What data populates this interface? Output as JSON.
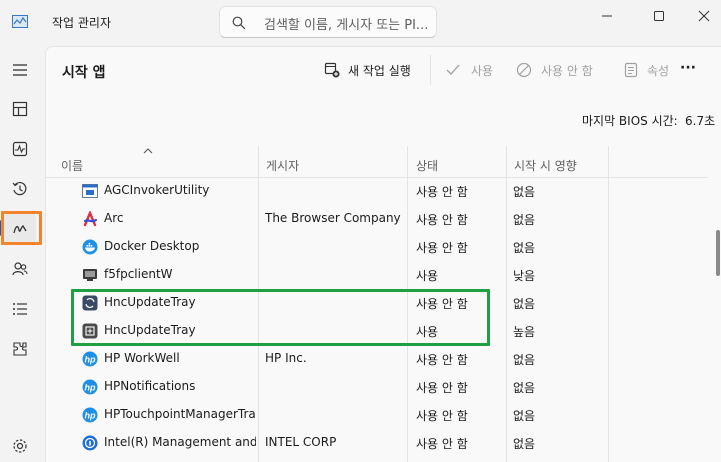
{
  "window": {
    "title": "작업 관리자",
    "search_placeholder": "검색할 이름, 게시자 또는 PI..."
  },
  "rail": [
    {
      "name": "menu-icon"
    },
    {
      "name": "processes-icon"
    },
    {
      "name": "performance-icon"
    },
    {
      "name": "app-history-icon"
    },
    {
      "name": "startup-apps-icon",
      "active": true
    },
    {
      "name": "users-icon"
    },
    {
      "name": "details-icon"
    },
    {
      "name": "services-icon"
    },
    {
      "name": "settings-icon"
    }
  ],
  "page": {
    "title": "시작 앱",
    "bios_label": "마지막 BIOS 시간:",
    "bios_value": "6.7초"
  },
  "toolbar": {
    "new_task": "새 작업 실행",
    "enable": "사용",
    "disable": "사용 안 함",
    "properties": "속성",
    "more": "···"
  },
  "table": {
    "headers": [
      "이름",
      "게시자",
      "상태",
      "시작 시 영향"
    ],
    "rows": [
      {
        "name": "AGCInvokerUtility",
        "publisher": "",
        "status": "사용 안 함",
        "impact": "없음",
        "icon": "agc-icon"
      },
      {
        "name": "Arc",
        "publisher": "The Browser Company ...",
        "status": "사용 안 함",
        "impact": "없음",
        "icon": "arc-icon"
      },
      {
        "name": "Docker Desktop",
        "publisher": "",
        "status": "사용 안 함",
        "impact": "없음",
        "icon": "docker-icon"
      },
      {
        "name": "f5fpclientW",
        "publisher": "",
        "status": "사용",
        "impact": "낮음",
        "icon": "f5-icon"
      },
      {
        "name": "HncUpdateTray",
        "publisher": "",
        "status": "사용 안 함",
        "impact": "없음",
        "icon": "hnc-icon"
      },
      {
        "name": "HncUpdateTray",
        "publisher": "",
        "status": "사용",
        "impact": "높음",
        "icon": "hnc-icon"
      },
      {
        "name": "HP WorkWell",
        "publisher": "HP Inc.",
        "status": "사용 안 함",
        "impact": "없음",
        "icon": "hp-icon"
      },
      {
        "name": "HPNotifications",
        "publisher": "",
        "status": "사용 안 함",
        "impact": "없음",
        "icon": "hp-icon"
      },
      {
        "name": "HPTouchpointManagerTray",
        "publisher": "",
        "status": "사용 안 함",
        "impact": "없음",
        "icon": "hp-icon"
      },
      {
        "name": "Intel(R) Management and...",
        "publisher": "INTEL CORP",
        "status": "사용 안 함",
        "impact": "없음",
        "icon": "intel-icon"
      }
    ]
  },
  "colors": {
    "accent": "#0a64c8",
    "highlight_orange": "#f2852c",
    "highlight_green": "#1ea043"
  }
}
